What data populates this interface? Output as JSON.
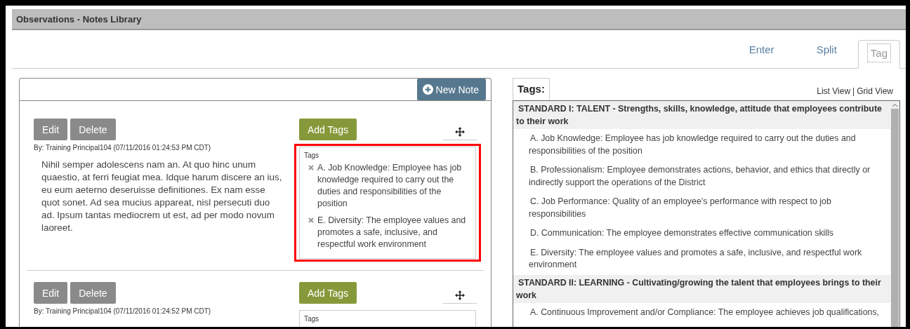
{
  "window": {
    "title": "Observations - Notes Library"
  },
  "tabs": [
    {
      "label": "Enter",
      "selected": false
    },
    {
      "label": "Split",
      "selected": false
    },
    {
      "label": "Tag",
      "selected": true
    }
  ],
  "notes_panel": {
    "new_note_button": "New Note",
    "notes": [
      {
        "edit_button": "Edit",
        "delete_button": "Delete",
        "byline": "By: Training Principal104 (07/11/2016 01:24:53 PM CDT)",
        "body": "Nihil semper adolescens nam an. At quo hinc unum quaestio, at ferri feugiat mea. Idque harum discere an ius, eu eum aeterno deseruisse definitiones. Ex nam esse quot sonet. Ad sea mucius appareat, nisl persecuti duo ad. Ipsum tantas mediocrem ut est, ad per modo novum laoreet.",
        "add_tags_button": "Add Tags",
        "tags_label": "Tags",
        "highlighted": true,
        "tags": [
          "A. Job Knowledge: Employee has job knowledge required to carry out the duties and responsibilities of the position",
          "E. Diversity: The employee values and promotes a safe, inclusive, and respectful work environment"
        ]
      },
      {
        "edit_button": "Edit",
        "delete_button": "Delete",
        "byline": "By: Training Principal104 (07/11/2016 01:24:52 PM CDT)",
        "add_tags_button": "Add Tags",
        "tags_label": "Tags",
        "highlighted": false
      }
    ]
  },
  "tags_panel": {
    "title": "Tags:",
    "list_view_link": "List View",
    "separator": "|",
    "grid_view_link": "Grid View",
    "standards": [
      {
        "heading": "STANDARD I: TALENT - Strengths, skills, knowledge, attitude that employees contribute to their work",
        "items": [
          "A. Job Knowledge: Employee has job knowledge required to carry out the duties and responsibilities of the position",
          "B. Professionalism: Employee demonstrates actions, behavior, and ethics that directly or indirectly support the operations of the District",
          "C. Job Performance: Quality of an employee’s performance with respect to job responsibilities",
          "D. Communication: The employee demonstrates effective communication skills",
          "E. Diversity: The employee values and promotes a safe, inclusive, and respectful work environment"
        ]
      },
      {
        "heading": "STANDARD II: LEARNING - Cultivating/growing the talent that employees brings to their work",
        "items": [
          "A. Continuous Improvement and/or Compliance: The employee achieves job qualifications,"
        ]
      }
    ]
  }
}
